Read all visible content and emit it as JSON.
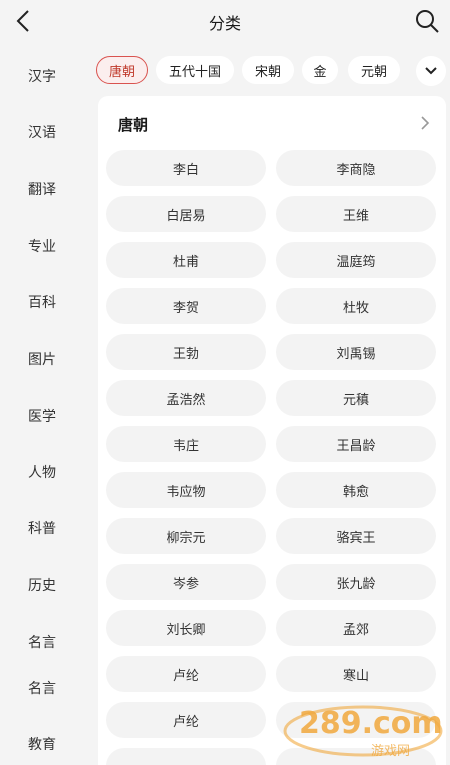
{
  "header": {
    "title": "分类",
    "back_icon": "back-icon",
    "search_icon": "search-icon"
  },
  "sidebar": {
    "items": [
      {
        "label": "汉字"
      },
      {
        "label": "汉语"
      },
      {
        "label": "翻译"
      },
      {
        "label": "专业"
      },
      {
        "label": "百科"
      },
      {
        "label": "图片"
      },
      {
        "label": "医学"
      },
      {
        "label": "人物"
      },
      {
        "label": "科普"
      },
      {
        "label": "历史"
      },
      {
        "label": "名言"
      },
      {
        "label": "名言"
      },
      {
        "label": "教育"
      }
    ]
  },
  "chips": {
    "items": [
      {
        "label": "唐朝",
        "active": true
      },
      {
        "label": "五代十国"
      },
      {
        "label": "宋朝"
      },
      {
        "label": "金"
      },
      {
        "label": "元朝"
      }
    ],
    "more_icon": "chevron-down-icon"
  },
  "panel": {
    "title": "唐朝",
    "arrow_icon": "chevron-right-icon",
    "poets": [
      "李白",
      "李商隐",
      "白居易",
      "王维",
      "杜甫",
      "温庭筠",
      "李贺",
      "杜牧",
      "王勃",
      "刘禹锡",
      "孟浩然",
      "元稹",
      "韦庄",
      "王昌龄",
      "韦应物",
      "韩愈",
      "柳宗元",
      "骆宾王",
      "岑参",
      "张九龄",
      "刘长卿",
      "孟郊",
      "卢纶",
      "寒山",
      "卢纶",
      "",
      "",
      ""
    ]
  },
  "watermark": {
    "text": "289.com",
    "subtext": "游戏网"
  },
  "colors": {
    "accent": "#d9534f",
    "accent_bg": "#fbeeee",
    "page_bg": "#f4f4f4",
    "pill_bg": "#f3f3f3"
  }
}
